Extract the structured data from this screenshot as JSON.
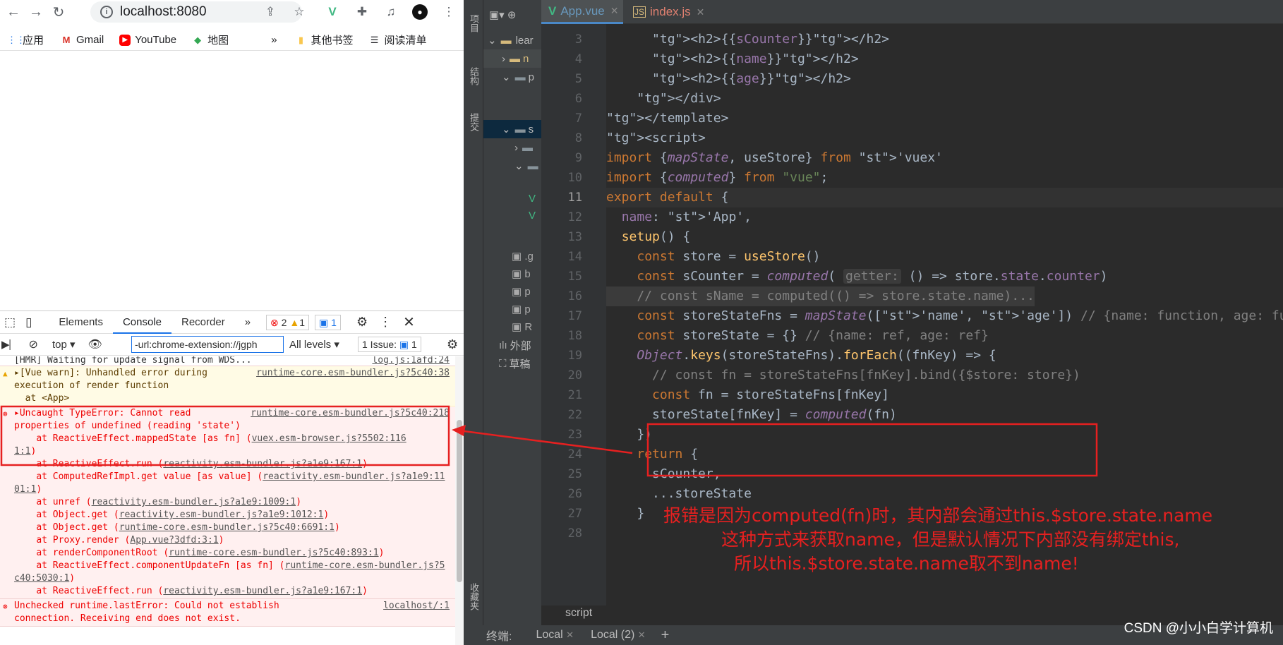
{
  "browser": {
    "url": "localhost:8080",
    "bookmarks": [
      {
        "label": "应用",
        "icon": "apps-grid-icon"
      },
      {
        "label": "Gmail",
        "icon": "gmail-icon"
      },
      {
        "label": "YouTube",
        "icon": "youtube-icon"
      },
      {
        "label": "地图",
        "icon": "maps-icon"
      },
      {
        "label": "其他书签",
        "icon": "folder-icon"
      },
      {
        "label": "阅读清单",
        "icon": "reading-list-icon"
      }
    ],
    "more_bookmarks": "»"
  },
  "devtools": {
    "tabs": [
      "Elements",
      "Console",
      "Recorder",
      "»"
    ],
    "active_tab": "Console",
    "errors_count": "2",
    "warnings_count": "1",
    "info_count": "1",
    "context": "top",
    "filter_value": "-url:chrome-extension://jgph",
    "levels": "All levels",
    "issues": "1 Issue:",
    "issues_count": "1",
    "messages": {
      "hmr_text": "[HMR] Waiting for update signal from WDS...",
      "hmr_src": "log.js:1afd:24",
      "warn_text": "[Vue warn]: Unhandled error during ",
      "warn_text2": "execution of render function",
      "warn_text3": "  at <App>",
      "warn_src": "runtime-core.esm-bundler.js?5c40:38",
      "err_title": "Uncaught TypeError: Cannot read",
      "err_title2": "properties of undefined (reading 'state')",
      "err_src": "runtime-core.esm-bundler.js?5c40:218",
      "err_at1": "    at ReactiveEffect.mappedState [as fn] (",
      "err_at1_link": "vuex.esm-browser.js?5502:116",
      "err_at1_link2": "1:1",
      "stack": [
        {
          "prefix": "    at ReactiveEffect.run (",
          "link": "reactivity.esm-bundler.js?a1e9:167:1",
          "suffix": ")"
        },
        {
          "prefix": "    at ComputedRefImpl.get value [as value] (",
          "link": "reactivity.esm-bundler.js?a1e9:1101:1",
          "suffix": ")"
        },
        {
          "prefix": "    at unref (",
          "link": "reactivity.esm-bundler.js?a1e9:1009:1",
          "suffix": ")"
        },
        {
          "prefix": "    at Object.get (",
          "link": "reactivity.esm-bundler.js?a1e9:1012:1",
          "suffix": ")"
        },
        {
          "prefix": "    at Object.get (",
          "link": "runtime-core.esm-bundler.js?5c40:6691:1",
          "suffix": ")"
        },
        {
          "prefix": "    at Proxy.render (",
          "link": "App.vue?3dfd:3:1",
          "suffix": ")"
        },
        {
          "prefix": "    at renderComponentRoot (",
          "link": "runtime-core.esm-bundler.js?5c40:893:1",
          "suffix": ")"
        },
        {
          "prefix": "    at ReactiveEffect.componentUpdateFn [as fn] (",
          "link": "runtime-core.esm-bundler.js?5c40:5030:1",
          "suffix": ")"
        },
        {
          "prefix": "    at ReactiveEffect.run (",
          "link": "reactivity.esm-bundler.js?a1e9:167:1",
          "suffix": ")"
        }
      ],
      "err2_text": "Unchecked runtime.lastError: Could not establish",
      "err2_text2": "connection. Receiving end does not exist.",
      "err2_src": "localhost/:1"
    }
  },
  "ide": {
    "strip_labels": [
      "项目",
      "结构",
      "提交",
      "收藏夹"
    ],
    "project_rows": [
      "lear",
      "n",
      "p",
      "s",
      "外部",
      "草稿"
    ],
    "tabs": [
      {
        "label": "App.vue",
        "active": true
      },
      {
        "label": "index.js",
        "active": false
      }
    ],
    "line_numbers": [
      "3",
      "4",
      "5",
      "6",
      "7",
      "8",
      "9",
      "10",
      "11",
      "12",
      "13",
      "14",
      "15",
      "16",
      "17",
      "18",
      "19",
      "20",
      "21",
      "22",
      "23",
      "24",
      "25",
      "26",
      "27",
      "28"
    ],
    "code_lines": [
      "      <h2>{{sCounter}}</h2>",
      "      <h2>{{name}}</h2>",
      "      <h2>{{age}}</h2>",
      "    </div>",
      "</template>",
      "<script>",
      "import {mapState, useStore} from 'vuex'",
      "import {computed} from \"vue\";",
      "export default {",
      "  name: 'App',",
      "  setup() {",
      "    const store = useStore()",
      "    const sCounter = computed( getter: () => store.state.counter)",
      "    // const sName = computed(() => store.state.name)...",
      "    const storeStateFns = mapState(['name', 'age']) // {name: function, age: function}",
      "    const storeState = {} // {name: ref, age: ref}",
      "    Object.keys(storeStateFns).forEach((fnKey) => {",
      "      // const fn = storeStateFns[fnKey].bind({$store: store})",
      "      const fn = storeStateFns[fnKey]",
      "      storeState[fnKey] = computed(fn)",
      "    })",
      "    return {",
      "      sCounter,",
      "      ...storeState",
      "    }",
      ""
    ],
    "breadcrumb": "script",
    "bottom": [
      "终端:",
      "Local",
      "Local (2)",
      "+"
    ]
  },
  "annotation": {
    "line1": "报错是因为computed(fn)时，其内部会通过this.$store.state.name",
    "line2": "这种方式来获取name，但是默认情况下内部没有绑定this,",
    "line3": "所以this.$store.state.name取不到name!"
  },
  "watermark": "CSDN @小小白学计算机",
  "colors": {
    "annotation": "#e62020",
    "ide_bg": "#2b2b2b",
    "devtools_error_bg": "#fff0f0"
  }
}
